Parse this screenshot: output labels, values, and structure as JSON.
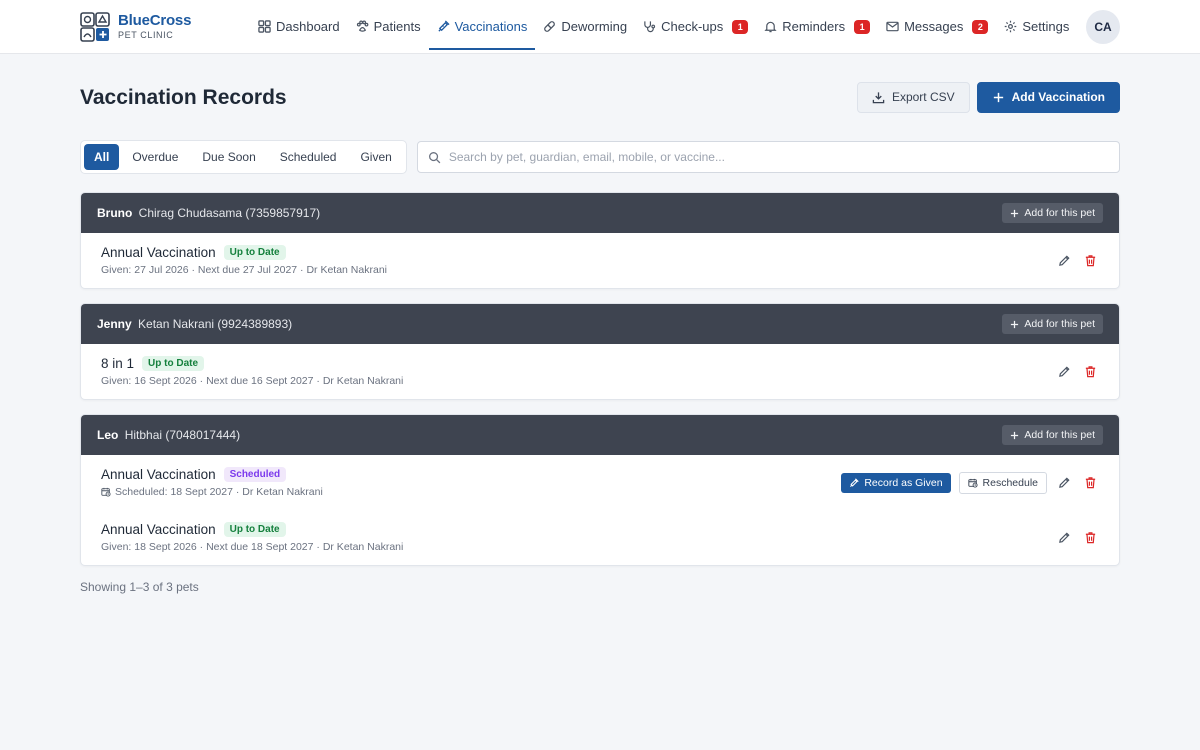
{
  "brand": {
    "name": "BlueCross",
    "subtitle": "PET CLINIC"
  },
  "nav": [
    {
      "label": "Dashboard",
      "icon": "grid-icon",
      "badge": ""
    },
    {
      "label": "Patients",
      "icon": "paw-icon",
      "badge": ""
    },
    {
      "label": "Vaccinations",
      "icon": "syringe-icon",
      "badge": "",
      "active": true
    },
    {
      "label": "Deworming",
      "icon": "pill-icon",
      "badge": ""
    },
    {
      "label": "Check-ups",
      "icon": "stethoscope-icon",
      "badge": "1"
    },
    {
      "label": "Reminders",
      "icon": "bell-icon",
      "badge": "1"
    },
    {
      "label": "Messages",
      "icon": "mail-icon",
      "badge": "2"
    },
    {
      "label": "Settings",
      "icon": "gear-icon",
      "badge": ""
    }
  ],
  "user": {
    "initials": "CA"
  },
  "page": {
    "title": "Vaccination Records",
    "export_label": "Export CSV",
    "add_label": "Add Vaccination"
  },
  "filters": {
    "tabs": [
      "All",
      "Overdue",
      "Due Soon",
      "Scheduled",
      "Given"
    ],
    "active": "All"
  },
  "search": {
    "placeholder": "Search by pet, guardian, email, mobile, or vaccine...",
    "value": ""
  },
  "groups": [
    {
      "pet": "Bruno",
      "owner": "Chirag Chudasama (7359857917)",
      "add_label": "Add for this pet",
      "records": [
        {
          "name": "Annual Vaccination",
          "status": "Up to Date",
          "status_type": "ok",
          "meta": "Given: 27 Jul 2026 · Next due 27 Jul 2027 · Dr Ketan Nakrani"
        }
      ]
    },
    {
      "pet": "Jenny",
      "owner": "Ketan Nakrani (9924389893)",
      "add_label": "Add for this pet",
      "records": [
        {
          "name": "8 in 1",
          "status": "Up to Date",
          "status_type": "ok",
          "meta": "Given: 16 Sept 2026 · Next due 16 Sept 2027 · Dr Ketan Nakrani"
        }
      ]
    },
    {
      "pet": "Leo",
      "owner": "Hitbhai (7048017444)",
      "add_label": "Add for this pet",
      "records": [
        {
          "name": "Annual Vaccination",
          "status": "Scheduled",
          "status_type": "sched",
          "meta": "Scheduled: 18 Sept 2027 · Dr Ketan Nakrani",
          "record_label": "Record as Given",
          "reschedule_label": "Reschedule"
        },
        {
          "name": "Annual Vaccination",
          "status": "Up to Date",
          "status_type": "ok",
          "meta": "Given: 18 Sept 2026 · Next due 18 Sept 2027 · Dr Ketan Nakrani"
        }
      ]
    }
  ],
  "footer": {
    "count_text": "Showing 1–3 of 3 pets"
  },
  "colors": {
    "primary": "#1e5aa0",
    "header_dark": "#3e4450",
    "danger": "#dc2626",
    "ok_text": "#15803d",
    "sched_text": "#7c3aed"
  }
}
